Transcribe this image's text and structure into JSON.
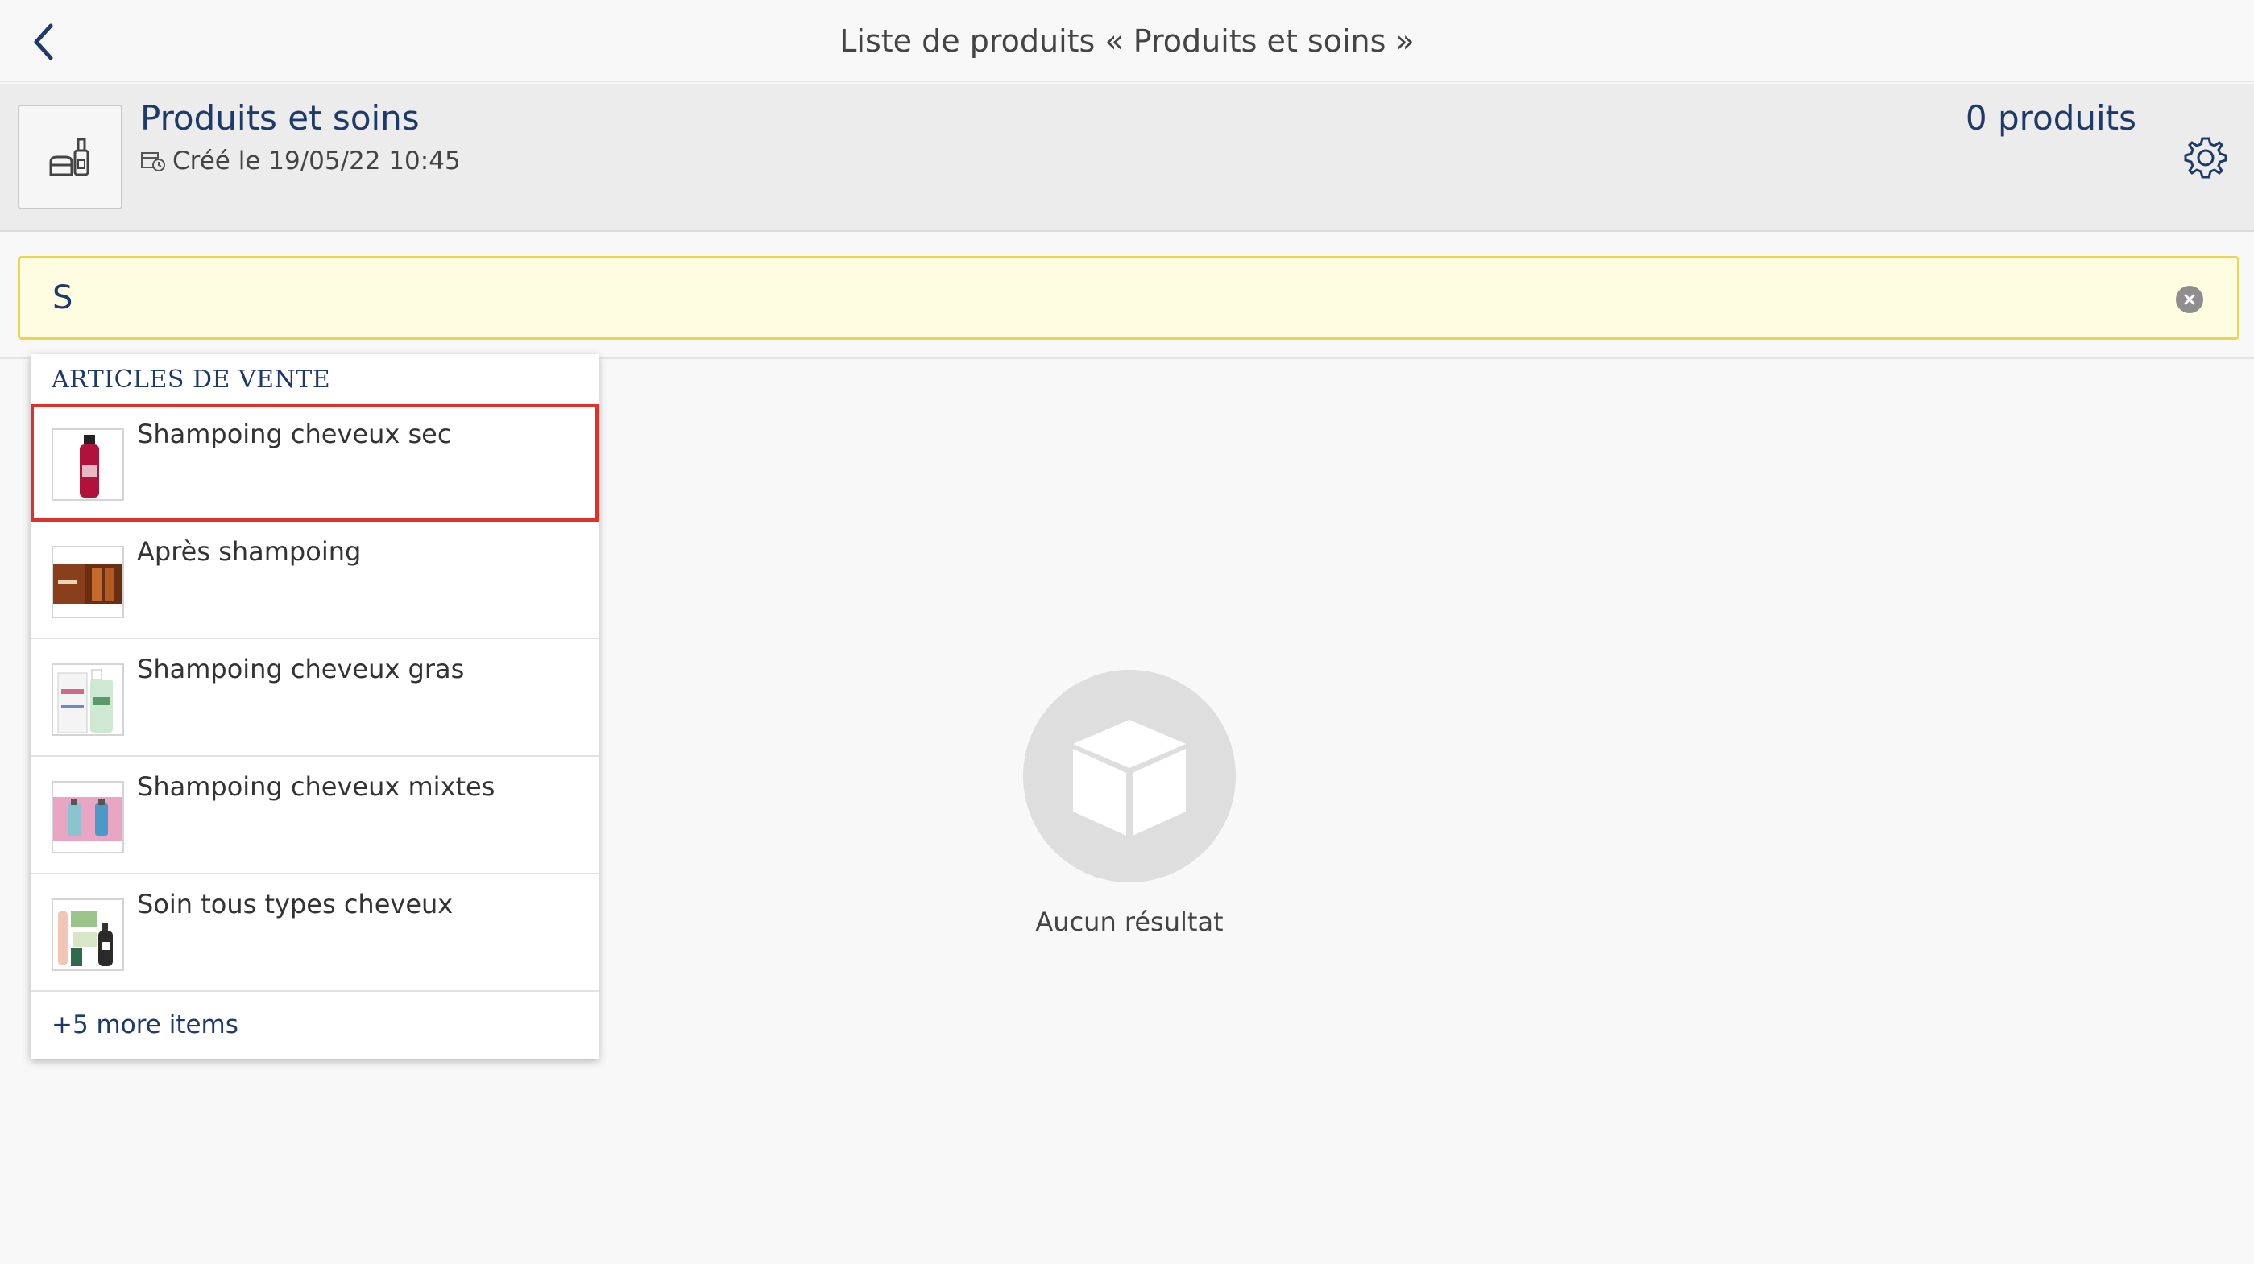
{
  "topbar": {
    "title": "Liste de produits « Produits et soins »",
    "back_icon": "chevron-left-icon"
  },
  "list_header": {
    "name": "Produits et soins",
    "created": "Créé le 19/05/22 10:45",
    "count": "0 produits",
    "thumb_icon": "cosmetics-icon",
    "settings_icon": "gear-icon"
  },
  "search": {
    "value": "S",
    "clear_icon": "clear-circle-icon"
  },
  "dropdown": {
    "section_title": "ARTICLES DE VENTE",
    "items": [
      {
        "label": "Shampoing cheveux sec",
        "selected": true
      },
      {
        "label": "Après shampoing",
        "selected": false
      },
      {
        "label": "Shampoing cheveux gras",
        "selected": false
      },
      {
        "label": "Shampoing cheveux mixtes",
        "selected": false
      },
      {
        "label": "Soin tous types cheveux",
        "selected": false
      }
    ],
    "more_label": "+5 more items"
  },
  "empty_state": {
    "text": "Aucun résultat",
    "icon": "box-icon"
  },
  "colors": {
    "accent": "#1e3a6b",
    "search_bg": "#fefde2",
    "search_border": "#ead54c",
    "selection_border": "#e0302a"
  }
}
